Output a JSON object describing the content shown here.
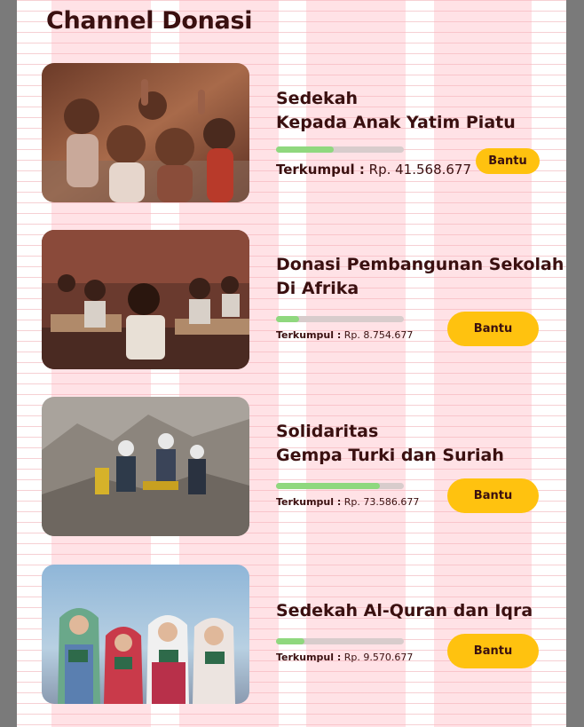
{
  "page": {
    "title": "Channel Donasi"
  },
  "colors": {
    "accent": "#ffc20f",
    "progress": "#8fd87e",
    "text": "#3a1010"
  },
  "campaigns": [
    {
      "title_line1": "Sedekah",
      "title_line2": "Kepada Anak Yatim Piatu",
      "progress": 0.45,
      "raised_label": "Terkumpul :",
      "raised_value": "Rp. 41.568.677",
      "button_label": "Bantu",
      "image": "children-smiling-photo"
    },
    {
      "title_line1": "Donasi Pembangunan Sekolah",
      "title_line2": "Di Afrika",
      "progress": 0.18,
      "raised_label": "Terkumpul :",
      "raised_value": "Rp. 8.754.677",
      "button_label": "Bantu",
      "image": "classroom-students-photo"
    },
    {
      "title_line1": "Solidaritas",
      "title_line2": "Gempa Turki dan Suriah",
      "progress": 0.81,
      "raised_label": "Terkumpul :",
      "raised_value": "Rp. 73.586.677",
      "button_label": "Bantu",
      "image": "earthquake-rescue-photo"
    },
    {
      "title_line1": "Sedekah Al-Quran dan Iqra",
      "title_line2": "",
      "progress": 0.22,
      "raised_label": "Terkumpul :",
      "raised_value": "Rp. 9.570.677",
      "button_label": "Bantu",
      "image": "girls-holding-quran-photo"
    }
  ]
}
